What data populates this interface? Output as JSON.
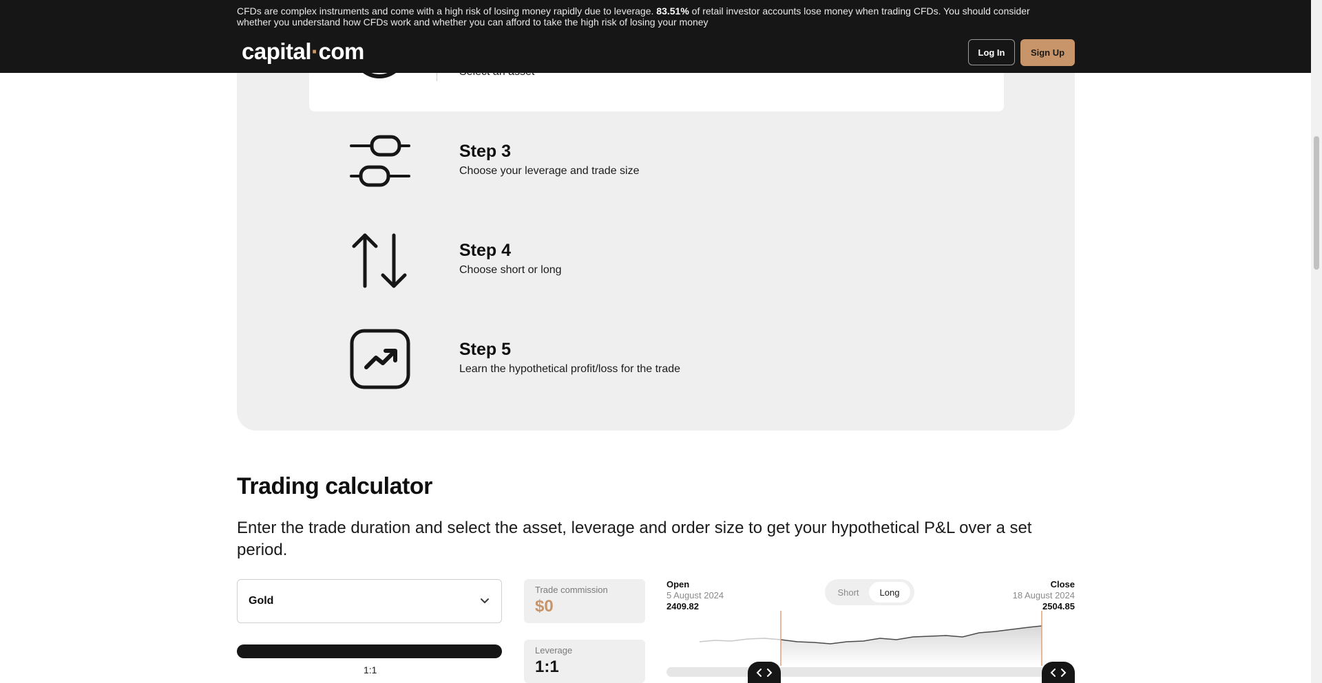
{
  "header": {
    "risk_prefix": "CFDs are complex instruments and come with a high risk of losing money rapidly due to leverage.",
    "risk_percent": "83.51%",
    "risk_suffix": "of retail investor accounts lose money when trading CFDs. You should consider whether you understand how CFDs work and whether you can afford to take the high risk of losing your money",
    "logo_left": "capital",
    "logo_dot": "·",
    "logo_right": "com",
    "login_label": "Log In",
    "signup_label": "Sign Up",
    "accent_color": "#c8946a"
  },
  "steps": {
    "step2_desc": "Select an asset",
    "items": [
      {
        "title": "Step 3",
        "desc": "Choose your leverage and trade size",
        "icon": "sliders-icon"
      },
      {
        "title": "Step 4",
        "desc": "Choose short or long",
        "icon": "up-down-arrows-icon"
      },
      {
        "title": "Step 5",
        "desc": "Learn the hypothetical profit/loss for the trade",
        "icon": "trend-up-icon"
      }
    ]
  },
  "calculator": {
    "title": "Trading calculator",
    "intro": "Enter the trade duration and select the asset, leverage and order size to get your hypothetical P&L over a set period.",
    "asset": "Gold",
    "leverage_caption": "1:1",
    "commission_label": "Trade commission",
    "commission_value": "$0",
    "leverage_label": "Leverage",
    "leverage_value": "1:1",
    "open_label": "Open",
    "open_date": "5 August 2024",
    "open_price": "2409.82",
    "close_label": "Close",
    "close_date": "18 August 2024",
    "close_price": "2504.85",
    "short_label": "Short",
    "long_label": "Long",
    "selected_direction": "Long"
  }
}
